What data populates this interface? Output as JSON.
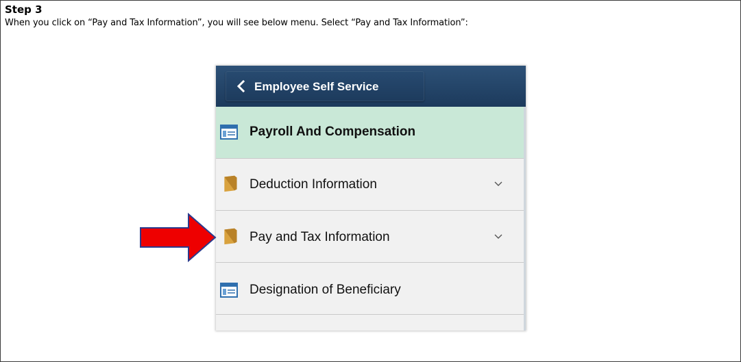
{
  "instructions": {
    "step_title": "Step 3",
    "description": "When you click on “Pay and Tax Information”, you will see below menu. Select “Pay and Tax Information”:"
  },
  "panel": {
    "back_button_label": "Employee Self Service",
    "items": [
      {
        "label": "Payroll And Compensation",
        "icon": "table-icon",
        "selected": true,
        "expandable": false
      },
      {
        "label": "Deduction Information",
        "icon": "folder-icon",
        "selected": false,
        "expandable": true
      },
      {
        "label": "Pay and Tax Information",
        "icon": "folder-icon",
        "selected": false,
        "expandable": true
      },
      {
        "label": "Designation of Beneficiary",
        "icon": "table-icon",
        "selected": false,
        "expandable": false
      }
    ]
  },
  "colors": {
    "header_navy": "#1f3f61",
    "selected_green": "#c9e8d7",
    "folder_gold": "#d9a23e",
    "table_blue": "#2f6fae",
    "arrow_red": "#ee0000",
    "arrow_outline": "#2b3a8c"
  },
  "annotation": {
    "arrow_icon": "red-arrow-icon",
    "points_to": "Pay and Tax Information"
  }
}
